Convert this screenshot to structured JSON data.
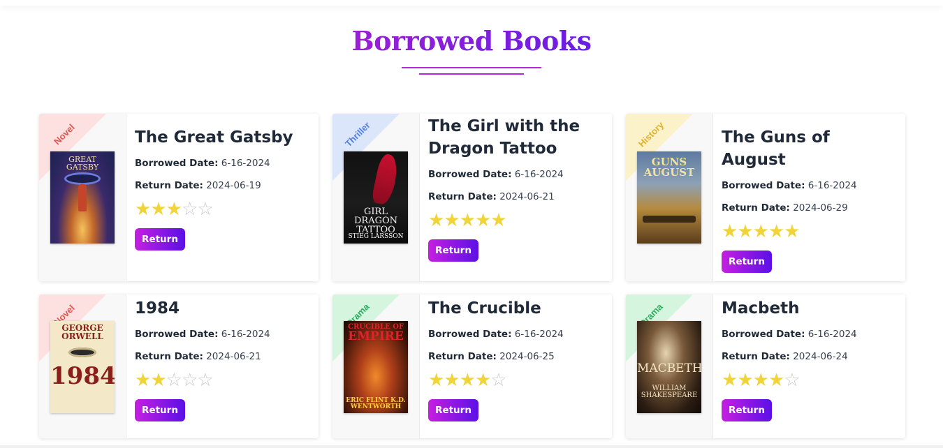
{
  "page": {
    "title": "Borrowed Books",
    "accent": "#9b1fd6",
    "labels": {
      "borrowed": "Borrowed Date:",
      "return": "Return Date:",
      "button": "Return"
    }
  },
  "books": [
    {
      "genre": "Novel",
      "genre_color": "#e0554f",
      "ribbon_bg": "#fde0e0",
      "title": "The Great Gatsby",
      "borrowed_date": "6-16-2024",
      "return_date": "2024-06-19",
      "rating": 3,
      "max_rating": 5,
      "cover": "gatsby"
    },
    {
      "genre": "Thriller",
      "genre_color": "#4f7fe0",
      "ribbon_bg": "#dce6fb",
      "title": "The Girl with the Dragon Tattoo",
      "borrowed_date": "6-16-2024",
      "return_date": "2024-06-21",
      "rating": 5,
      "max_rating": 5,
      "cover": "dragon"
    },
    {
      "genre": "History",
      "genre_color": "#e0b12c",
      "ribbon_bg": "#fbf2c9",
      "title": "The Guns of August",
      "borrowed_date": "6-16-2024",
      "return_date": "2024-06-29",
      "rating": 5,
      "max_rating": 5,
      "cover": "guns"
    },
    {
      "genre": "Novel",
      "genre_color": "#e0554f",
      "ribbon_bg": "#fde0e0",
      "title": "1984",
      "borrowed_date": "6-16-2024",
      "return_date": "2024-06-21",
      "rating": 2,
      "max_rating": 5,
      "cover": "1984"
    },
    {
      "genre": "Drama",
      "genre_color": "#2fae5f",
      "ribbon_bg": "#d6f5df",
      "title": "The Crucible",
      "borrowed_date": "6-16-2024",
      "return_date": "2024-06-25",
      "rating": 4,
      "max_rating": 5,
      "cover": "crucible"
    },
    {
      "genre": "Drama",
      "genre_color": "#2fae5f",
      "ribbon_bg": "#d6f5df",
      "title": "Macbeth",
      "borrowed_date": "6-16-2024",
      "return_date": "2024-06-24",
      "rating": 4,
      "max_rating": 5,
      "cover": "macbeth"
    }
  ],
  "covers": {
    "gatsby": {
      "line1": "GREAT",
      "line2": "GATSBY"
    },
    "dragon": {
      "line1": "GIRL",
      "line2": "DRAGON",
      "line3": "TATTOO",
      "author": "STIEG LARSSON"
    },
    "guns": {
      "line1": "GUNS",
      "line2": "AUGUST"
    },
    "1984": {
      "line1": "GEORGE",
      "line2": "ORWELL",
      "line3": "1984"
    },
    "crucible": {
      "line1": "CRUCIBLE OF",
      "line2": "EMPIRE",
      "author": "ERIC FLINT K.D. WENTWORTH"
    },
    "macbeth": {
      "line1": "MACBETH",
      "author": "WILLIAM SHAKESPEARE"
    }
  }
}
